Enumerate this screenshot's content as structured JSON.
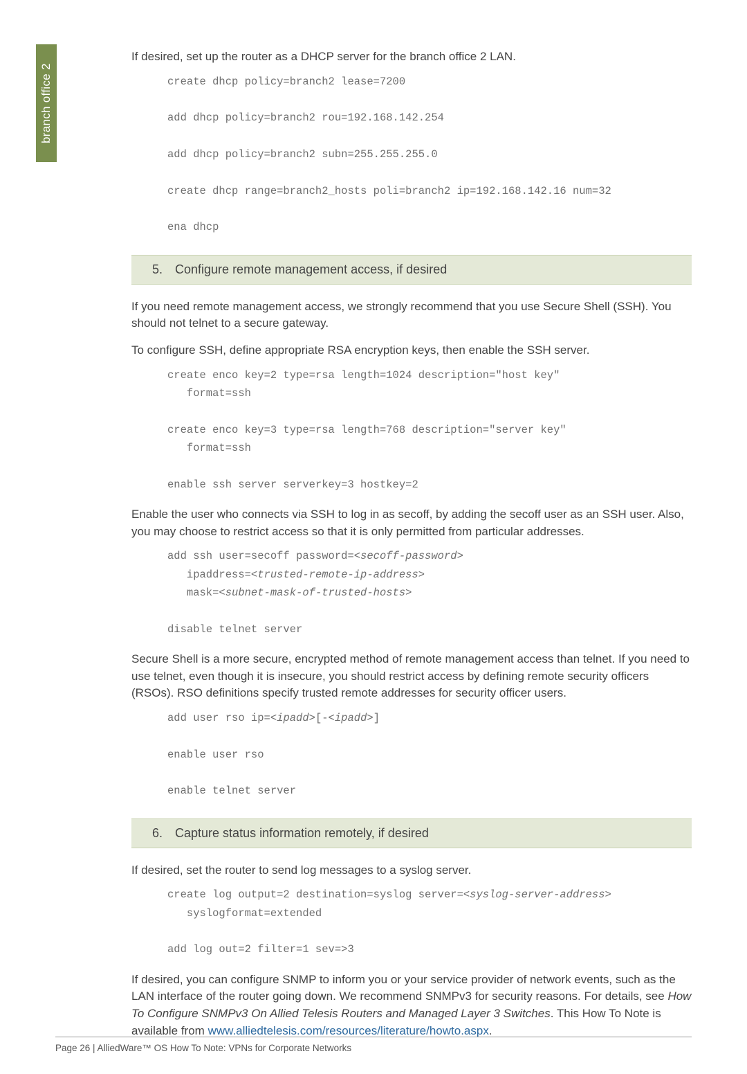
{
  "sideTab": "branch office 2",
  "p_intro1": "If desired, set up the router as a DHCP server for the branch office 2 LAN.",
  "code1": "create dhcp policy=branch2 lease=7200\n\nadd dhcp policy=branch2 rou=192.168.142.254\n\nadd dhcp policy=branch2 subn=255.255.255.0\n\ncreate dhcp range=branch2_hosts poli=branch2 ip=192.168.142.16 num=32\n\nena dhcp",
  "step5_num": "5.",
  "step5_title": "Configure remote management access, if desired",
  "p5a": "If you need remote management access, we strongly recommend that you use Secure Shell (SSH). You should not telnet to a secure gateway.",
  "p5b": "To configure SSH, define appropriate RSA encryption keys, then enable the SSH server.",
  "code5a": "create enco key=2 type=rsa length=1024 description=\"host key\"\n   format=ssh\n\ncreate enco key=3 type=rsa length=768 description=\"server key\"\n   format=ssh\n\nenable ssh server serverkey=3 hostkey=2",
  "p5c": "Enable the user who connects via SSH to log in as secoff, by adding the secoff user as an SSH user. Also, you may choose to restrict access so that it is only permitted from particular addresses.",
  "code5b_l1": "add ssh user=secoff password=<",
  "code5b_i1": "secoff-password",
  "code5b_l2": ">\n   ipaddress=<",
  "code5b_i2": "trusted-remote-ip-address",
  "code5b_l3": ">\n   mask=<",
  "code5b_i3": "subnet-mask-of-trusted-hosts",
  "code5b_l4": ">\n\ndisable telnet server",
  "p5d": "Secure Shell is a more secure, encrypted method of remote management access than telnet. If you need to use telnet, even though it is insecure, you should restrict access by defining remote security officers (RSOs). RSO definitions specify trusted remote addresses for security officer users.",
  "code5c_l1": "add user rso ip=<",
  "code5c_i1": "ipadd",
  "code5c_l2": ">[-<",
  "code5c_i2": "ipadd",
  "code5c_l3": ">]\n\nenable user rso\n\nenable telnet server",
  "step6_num": "6.",
  "step6_title": "Capture status information remotely, if desired",
  "p6a": "If desired, set the router to send log messages to a syslog server.",
  "code6_l1": "create log output=2 destination=syslog server=<",
  "code6_i1": "syslog-server-address",
  "code6_l2": ">\n   syslogformat=extended\n\nadd log out=2 filter=1 sev=>3",
  "p6b_1": "If desired, you can configure SNMP to inform you or your service provider of network events, such as the LAN interface of the router going down. We recommend SNMPv3 for security reasons. For details, see ",
  "p6b_em": "How To Configure SNMPv3 On Allied Telesis Routers and Managed Layer 3 Switches",
  "p6b_2": ". This How To Note is available from ",
  "p6b_link": "www.alliedtelesis.com/resources/literature/howto.aspx",
  "p6b_3": ".",
  "footer": "Page 26 | AlliedWare™ OS How To Note: VPNs for Corporate Networks"
}
